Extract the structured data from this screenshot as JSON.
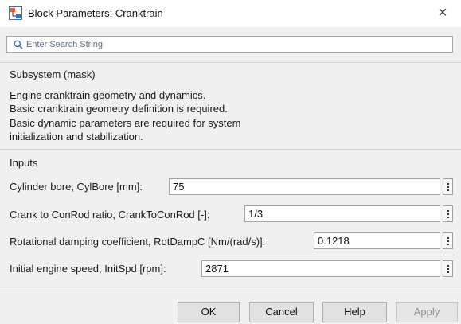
{
  "window": {
    "title": "Block Parameters: Cranktrain",
    "close_glyph": "×"
  },
  "search": {
    "placeholder": "Enter Search String",
    "value": ""
  },
  "subsystem": {
    "heading": "Subsystem (mask)",
    "description_lines": [
      "Engine cranktrain geometry and dynamics.",
      "Basic cranktrain geometry definition is required.",
      "Basic dynamic parameters are required for system",
      "initialization and stabilization."
    ]
  },
  "inputs": {
    "heading": "Inputs",
    "params": [
      {
        "label": "Cylinder bore, CylBore [mm]:",
        "value": "75"
      },
      {
        "label": "Crank to ConRod ratio, CrankToConRod [-]:",
        "value": "1/3"
      },
      {
        "label": "Rotational damping coefficient, RotDampC [Nm/(rad/s)]:",
        "value": "0.1218"
      },
      {
        "label": "Initial engine speed, InitSpd [rpm]:",
        "value": "2871"
      }
    ]
  },
  "buttons": {
    "ok": "OK",
    "cancel": "Cancel",
    "help": "Help",
    "apply": "Apply"
  },
  "icons": {
    "app": "block-parameters-icon",
    "search": "search-icon",
    "more": "more-options-icon"
  },
  "colors": {
    "dialog_bg": "#f0f0f0",
    "titlebar_bg": "#ffffff",
    "button_bg": "#e1e1e1"
  }
}
